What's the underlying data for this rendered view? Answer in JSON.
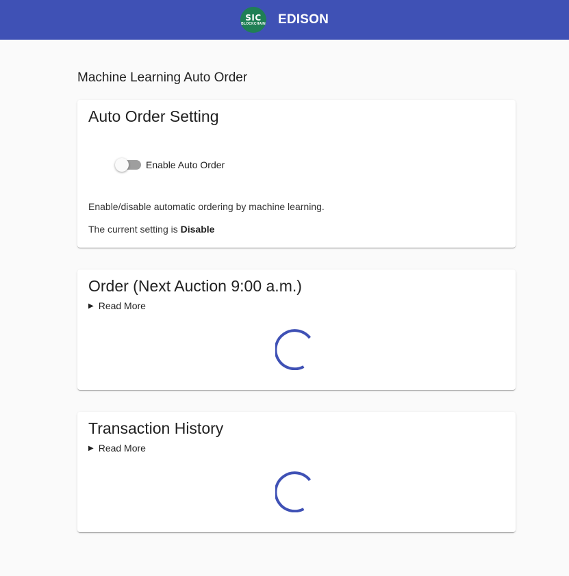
{
  "header": {
    "title": "EDISON",
    "logo_top": "SIC",
    "logo_bottom": "BLOCKCHAIN",
    "bar_color": "#3f51b5",
    "logo_color": "#1f7f55"
  },
  "page": {
    "title": "Machine Learning Auto Order"
  },
  "auto_order_card": {
    "title": "Auto Order Setting",
    "toggle_label": "Enable Auto Order",
    "toggle_on": false,
    "description": "Enable/disable automatic ordering by machine learning.",
    "current_prefix": "The current setting is",
    "current_value": "Disable"
  },
  "order_card": {
    "title": "Order (Next Auction 9:00 a.m.)",
    "read_more": "Read More",
    "triangle_icon": "▶"
  },
  "history_card": {
    "title": "Transaction History",
    "read_more": "Read More",
    "triangle_icon": "▶"
  },
  "spinner_color": "#3f51b5"
}
